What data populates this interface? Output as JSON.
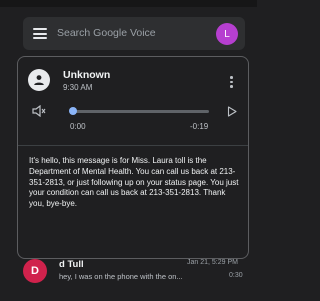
{
  "search": {
    "placeholder": "Search Google Voice"
  },
  "account": {
    "initial": "L",
    "color": "#b63fd0"
  },
  "voicemail": {
    "contact_name": "Unknown",
    "time": "9:30 AM",
    "player": {
      "current_time": "0:00",
      "remaining_time": "-0:19",
      "progress_fraction": 0.0
    },
    "transcript": "It's hello, this message is for Miss. Laura toll is the Department of Mental Health. You can call us back at 213-351-2813, or just following up on your status page. You just your condition can call us back at 213-351-2813. Thank you, bye-bye."
  },
  "messages": [
    {
      "initial": "D",
      "avatar_color": "#d0224c",
      "sender": "d Tull",
      "date": "Jan 21, 5:29 PM",
      "preview": "hey, I was on the phone with the on...",
      "duration": "0:30"
    }
  ],
  "icons": {
    "menu": "menu-icon",
    "person": "person-icon",
    "more": "more-vert-icon",
    "volume": "volume-icon",
    "play": "play-icon"
  }
}
